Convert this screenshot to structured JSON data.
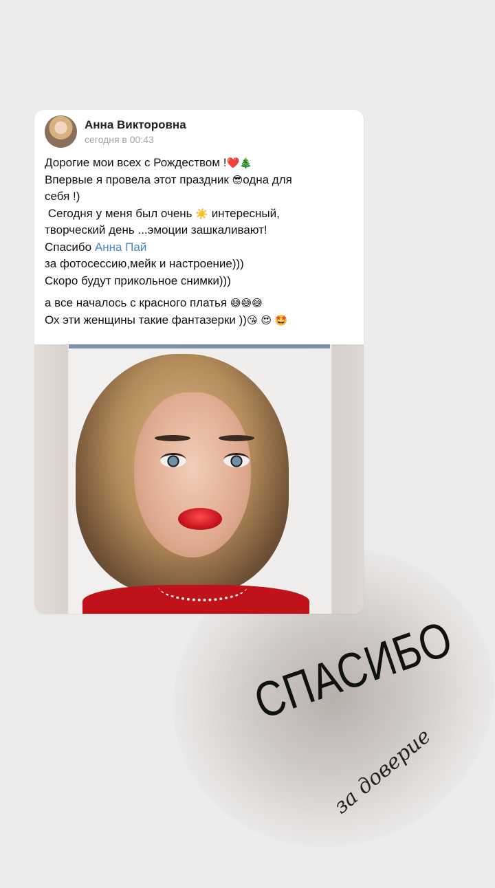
{
  "post": {
    "author": "Анна Викторовна",
    "time": "сегодня в 00:43",
    "lines": [
      "Дорогие мои всех с Рождеством !",
      "Впервые я провела этот праздник",
      "одна для",
      "себя !)",
      " Сегодня у меня был очень",
      "интересный,",
      "творческий день ...эмоции зашкаливают!",
      "Спасибо",
      "Анна Пай",
      "за фотосессию,мейк и настроение)))",
      "Скоро будут прикольное снимки)))",
      "а все началось с красного платья",
      "Ох эти женщины такие фантазерки ))"
    ],
    "emoji": {
      "heart": "❤️",
      "tree": "🎄",
      "sunglasses": "😎",
      "sun": "☀️",
      "sweat1": "😅",
      "sweat2": "😅",
      "sweat3": "😅",
      "kiss": "😘",
      "heart_eyes": "😍",
      "star_struck": "🤩"
    }
  },
  "overlay": {
    "title": "СПАСИБО",
    "subtitle": "за доверие"
  }
}
